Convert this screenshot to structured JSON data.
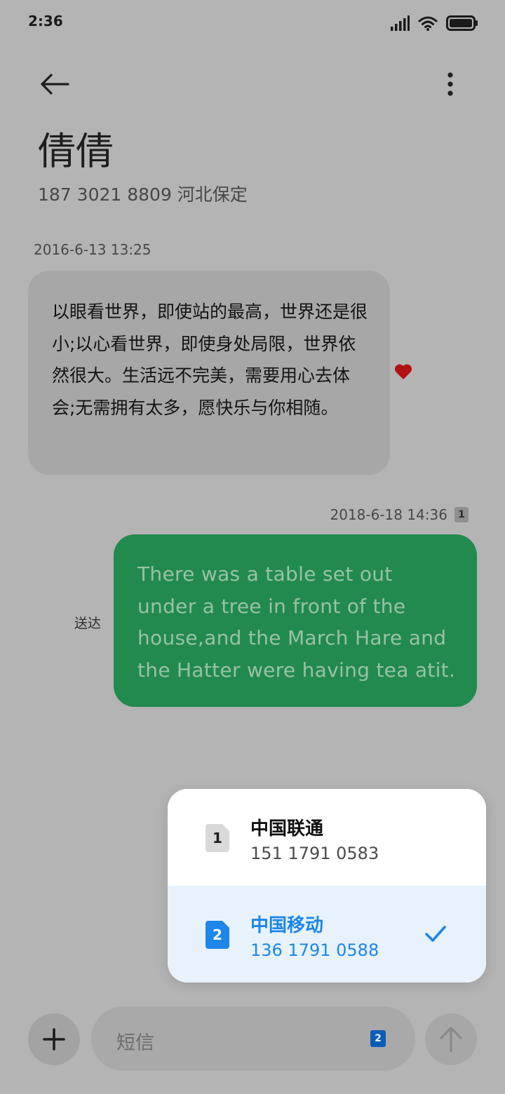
{
  "status_bar": {
    "time": "2:36"
  },
  "header": {
    "contact_name": "倩倩",
    "contact_subtitle": "187 3021 8809 河北保定"
  },
  "messages": [
    {
      "direction": "incoming",
      "timestamp": "2016-6-13 13:25",
      "text": "以眼看世界，即使站的最高，世界还是很小;以心看世界，即使身处局限，世界依然很大。生活远不完美，需要用心去体会;无需拥有太多，愿快乐与你相随。",
      "favorited": true
    },
    {
      "direction": "outgoing",
      "timestamp": "2018-6-18 14:36",
      "sim_slot": "1",
      "status": "送达",
      "text": "There was a table set out under a tree in front of the house,and the March Hare and the Hatter were having tea atit."
    }
  ],
  "sim_picker": {
    "options": [
      {
        "slot": "1",
        "carrier": "中国联通",
        "number": "151 1791 0583",
        "selected": false
      },
      {
        "slot": "2",
        "carrier": "中国移动",
        "number": "136 1791 0588",
        "selected": true
      }
    ]
  },
  "composer": {
    "placeholder": "短信",
    "sim_slot": "2"
  },
  "colors": {
    "scrim_background": "#b4b4b4",
    "incoming_bubble": "#a7a7a7",
    "outgoing_bubble": "#238a4f",
    "accent": "#1d86e8",
    "favorite": "#b31212"
  }
}
